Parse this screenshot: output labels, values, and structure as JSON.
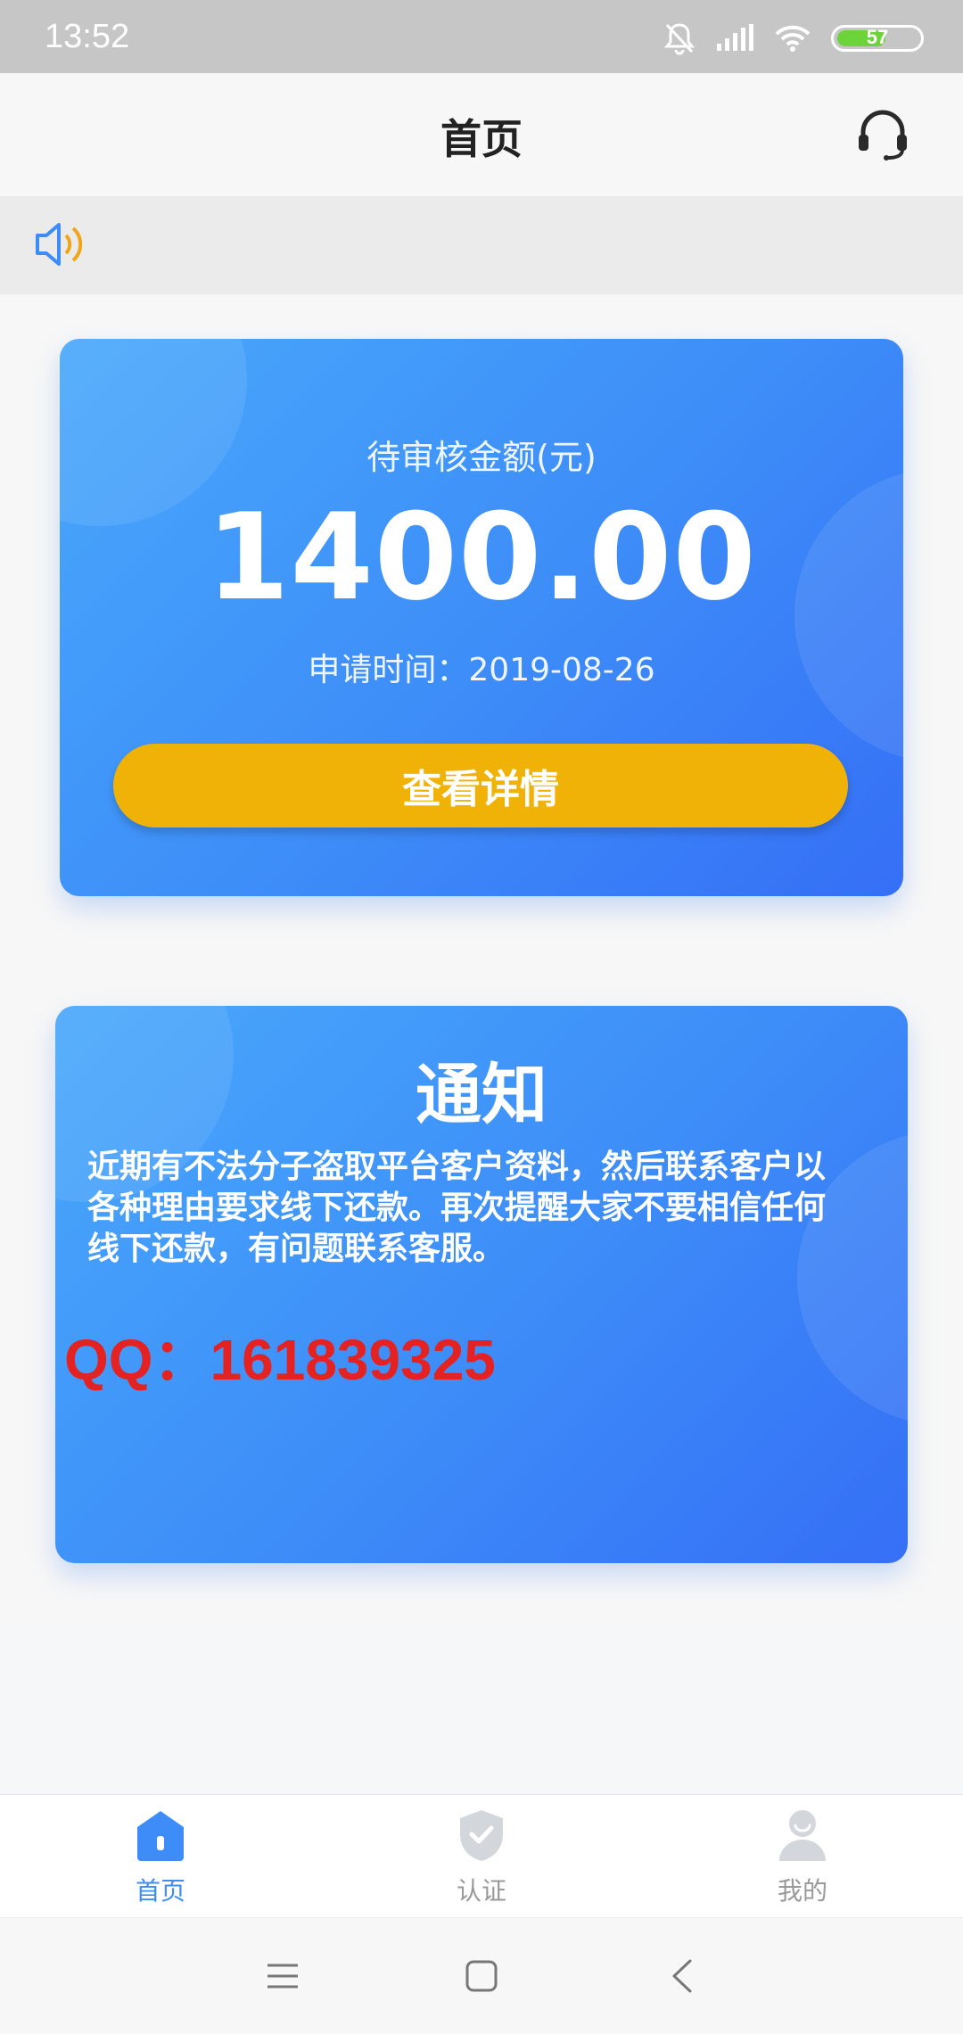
{
  "status_bar": {
    "time": "13:52",
    "battery": "57"
  },
  "header": {
    "title": "首页"
  },
  "review_card": {
    "label": "待审核金额(元)",
    "amount": "1400.00",
    "date": "申请时间：2019-08-26",
    "button": "查看详情"
  },
  "notice_card": {
    "title": "通知",
    "body": "近期有不法分子盗取平台客户资料，然后联系客户以各种理由要求线下还款。再次提醒大家不要相信任何线下还款，有问题联系客服。",
    "qq": "QQ：161839325"
  },
  "bottom_nav": [
    {
      "label": "首页",
      "icon": "home-icon",
      "active": true
    },
    {
      "label": "认证",
      "icon": "shield-check-icon",
      "active": false
    },
    {
      "label": "我的",
      "icon": "person-icon",
      "active": false
    }
  ],
  "colors": {
    "accent": "#3d8cf8",
    "button": "#f1b207",
    "qq_text": "#e52222"
  }
}
